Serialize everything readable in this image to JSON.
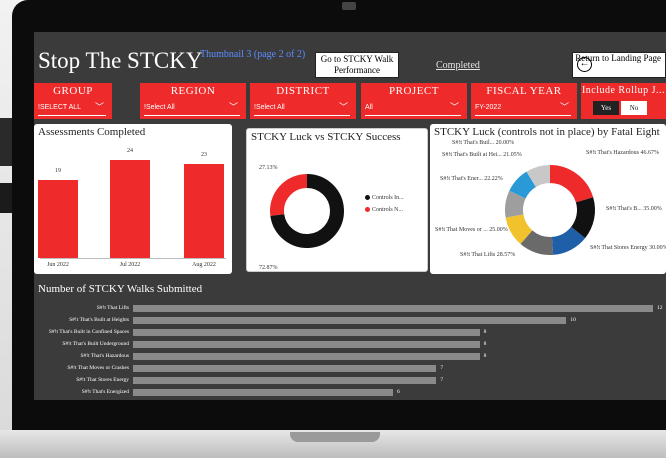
{
  "header": {
    "title": "Stop The STCKY",
    "thumbnail": "Thumbnail 3 (page 2 of 2)",
    "goto_label": "Go to STCKY Walk Performance",
    "completed_link": "Completed",
    "return_label": "Return to Landing Page"
  },
  "filters": {
    "group": {
      "label": "GROUP",
      "value": "!SELECT ALL"
    },
    "region": {
      "label": "REGION",
      "value": "!Select All"
    },
    "district": {
      "label": "DISTRICT",
      "value": "!Select All"
    },
    "project": {
      "label": "PROJECT",
      "value": "All"
    },
    "fiscal_year": {
      "label": "FISCAL YEAR",
      "value": "FY-2022"
    },
    "rollup": {
      "label": "Include Rollup J...",
      "yes": "Yes",
      "no": "No"
    }
  },
  "chart_data": [
    {
      "type": "bar",
      "title": "Assessments Completed",
      "categories": [
        "Jun 2022",
        "Jul 2022",
        "Aug 2022"
      ],
      "values": [
        19,
        24,
        23
      ],
      "ylim": [
        0,
        24
      ],
      "color": "#ee2a2a"
    },
    {
      "type": "pie",
      "title": "STCKY Luck vs STCKY Success",
      "labels": [
        "Controls In...",
        "Controls N..."
      ],
      "values": [
        72.87,
        27.13
      ],
      "value_labels": [
        "72.87%",
        "27.13%"
      ],
      "colors": [
        "#111111",
        "#ee2a2a"
      ],
      "legend": "right"
    },
    {
      "type": "pie",
      "title": "STCKY Luck (controls not in place) by Fatal Eight",
      "labels": [
        "S#!t That's Hazardous",
        "S#!t That's B...",
        "S#!t That Stores Energy",
        "S#!t That Lifts",
        "S#!t That Moves or ...",
        "S#!t That's Ener...",
        "S#!t That's Built at Hei...",
        "S#!t That's Buil..."
      ],
      "values": [
        46.67,
        35.0,
        30.0,
        28.57,
        25.0,
        22.22,
        21.05,
        20.0
      ],
      "value_labels": [
        "46.67%",
        "35.00%",
        "30.00%",
        "28.57%",
        "25.00%",
        "22.22%",
        "21.05%",
        "20.00%"
      ],
      "colors": [
        "#ee2a2a",
        "#111111",
        "#1f5fa8",
        "#6a6a6a",
        "#f2c22e",
        "#9e9e9e",
        "#2a9ad6",
        "#c8c8c8"
      ]
    },
    {
      "type": "bar",
      "orientation": "horizontal",
      "title": "Number of STCKY Walks Submitted",
      "categories": [
        "S#!t That Lifts",
        "S#!t That's Built at Heights",
        "S#!t That's Built in Confined Spaces",
        "S#!t That's Built Underground",
        "S#!t That's Hazardous",
        "S#!t That Moves or Crashes",
        "S#!t That Stores Energy",
        "S#!t That's Energized"
      ],
      "values": [
        12,
        10,
        8,
        8,
        8,
        7,
        7,
        6
      ],
      "xlim": [
        0,
        12
      ],
      "color": "#8a8a8a"
    }
  ]
}
